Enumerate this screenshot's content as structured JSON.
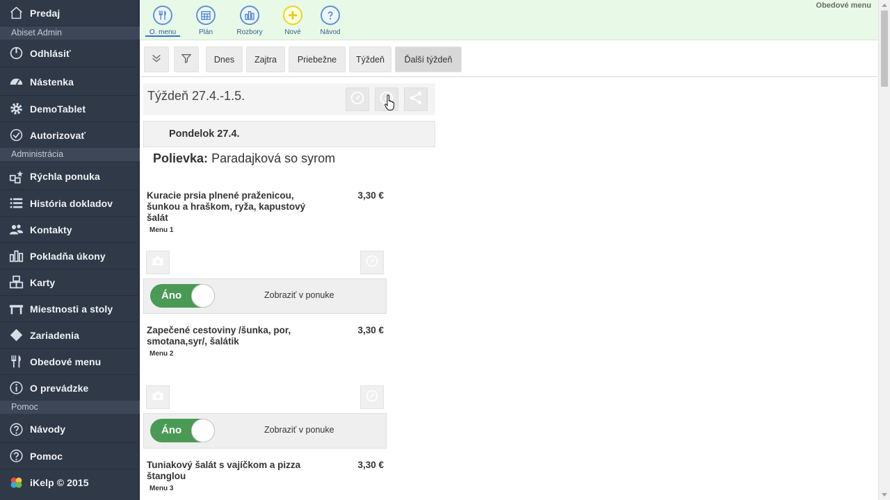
{
  "sidebar": {
    "items": [
      {
        "label": "Predaj",
        "icon": "home-icon"
      },
      {
        "label": "Odhlásiť",
        "icon": "power-icon"
      },
      {
        "label": "Nástenka",
        "icon": "dashboard-icon"
      },
      {
        "label": "DemoTablet",
        "icon": "gear-icon"
      },
      {
        "label": "Autorizovať",
        "icon": "check-circle-icon"
      },
      {
        "label": "Rýchla ponuka",
        "icon": "quick-offer-icon"
      },
      {
        "label": "História dokladov",
        "icon": "list-icon"
      },
      {
        "label": "Kontakty",
        "icon": "users-icon"
      },
      {
        "label": "Pokladňa úkony",
        "icon": "bar-chart-icon"
      },
      {
        "label": "Karty",
        "icon": "cards-icon"
      },
      {
        "label": "Miestnosti a stoly",
        "icon": "table-icon"
      },
      {
        "label": "Zariadenia",
        "icon": "diamond-icon"
      },
      {
        "label": "Obedové menu",
        "icon": "cutlery-icon"
      },
      {
        "label": "O prevádzke",
        "icon": "info-icon"
      },
      {
        "label": "Návody",
        "icon": "question-icon"
      },
      {
        "label": "Pomoc",
        "icon": "help-icon"
      },
      {
        "label": "iKelp © 2015",
        "icon": "ikelp-logo-icon"
      }
    ],
    "sections": [
      "Abiset Admin",
      "Administrácia",
      "Pomoc"
    ]
  },
  "toolbar": {
    "buttons": [
      {
        "label": "O. menu",
        "icon": "cutlery-icon"
      },
      {
        "label": "Plán",
        "icon": "calendar-icon"
      },
      {
        "label": "Rozbory",
        "icon": "bar-chart-icon"
      },
      {
        "label": "Nové",
        "icon": "plus-icon"
      },
      {
        "label": "Návod",
        "icon": "question-icon"
      }
    ],
    "title": "Obedové menu"
  },
  "filters": {
    "buttons": [
      "Dnes",
      "Zajtra",
      "Priebežne",
      "Týždeň",
      "Ďalší týždeň"
    ],
    "selected": "Ďalší týždeň"
  },
  "week": {
    "title": "Týždeň 27.4.-1.5."
  },
  "day": {
    "title": "Pondelok 27.4."
  },
  "soup": {
    "label": "Polievka:",
    "name": "Paradajková so syrom"
  },
  "meals": [
    {
      "name": "Kuracie prsia plnené praženicou, šunkou a hraškom, ryža, kapustový šalát",
      "price": "3,30 €",
      "menu": "Menu 1",
      "toggle": "Áno",
      "toggle_label": "Zobraziť v ponuke"
    },
    {
      "name": "Zapečené cestoviny /šunka, por, smotana,syr/, šalátik",
      "price": "3,30 €",
      "menu": "Menu 2",
      "toggle": "Áno",
      "toggle_label": "Zobraziť v ponuke"
    },
    {
      "name": "Tuniakový šalát s vajíčkom a pizza štanglou",
      "price": "3,30 €",
      "menu": "Menu 3"
    }
  ],
  "colors": {
    "sidebar_bg": "#2f3948",
    "toolbar_bg": "#e9f9e7",
    "toggle_on": "#4a9a55",
    "accent_blue": "#2f74c6"
  }
}
